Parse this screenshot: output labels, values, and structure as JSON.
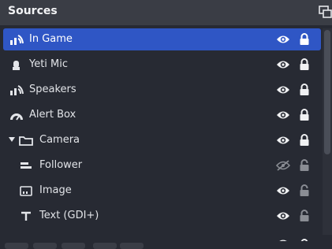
{
  "panel": {
    "title": "Sources"
  },
  "sources": [
    {
      "label": "In Game",
      "icon": "game-capture-icon",
      "visible": true,
      "locked": true,
      "selected": true
    },
    {
      "label": "Yeti Mic",
      "icon": "microphone-icon",
      "visible": true,
      "locked": true
    },
    {
      "label": "Speakers",
      "icon": "audio-output-icon",
      "visible": true,
      "locked": true
    },
    {
      "label": "Alert Box",
      "icon": "browser-source-icon",
      "visible": true,
      "locked": true
    },
    {
      "label": "Camera",
      "icon": "group-folder-icon",
      "visible": true,
      "locked": true,
      "expanded": true,
      "group": true
    },
    {
      "label": "Follower",
      "icon": "media-source-icon",
      "visible": false,
      "locked": false,
      "child": true
    },
    {
      "label": "Image",
      "icon": "image-icon",
      "visible": true,
      "locked": false,
      "child": true
    },
    {
      "label": "Text (GDI+)",
      "icon": "text-source-icon",
      "visible": true,
      "locked": false,
      "child": true
    }
  ],
  "colors": {
    "selected_row": "#2f56c5",
    "panel_bg": "#272a33",
    "titlebar_bg": "#3a3d45",
    "dim_icon": "#8a8d94"
  }
}
